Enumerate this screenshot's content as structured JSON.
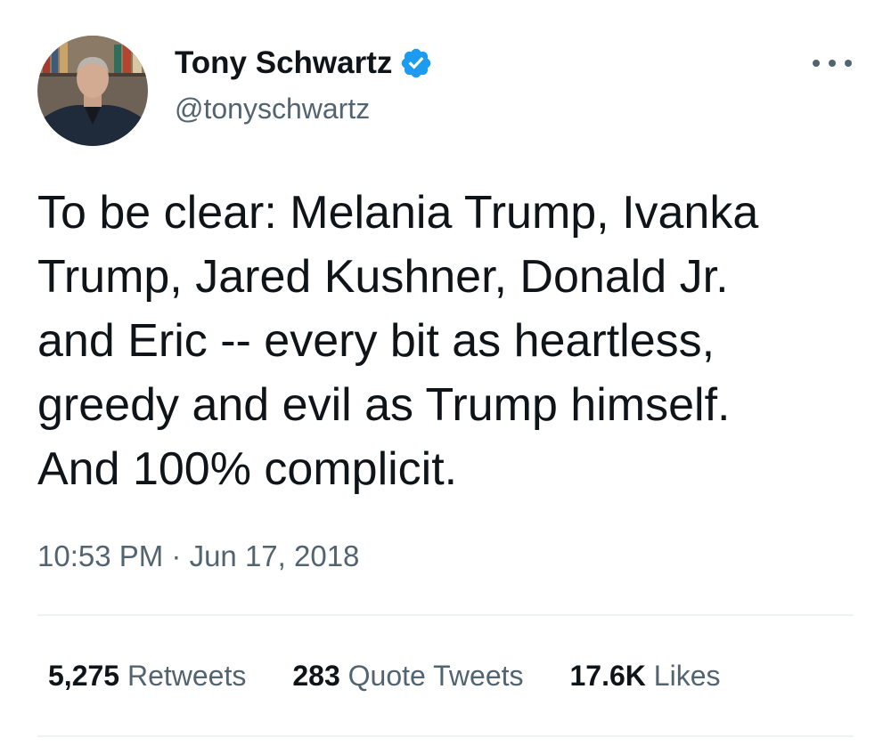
{
  "author": {
    "display_name": "Tony Schwartz",
    "handle": "@tonyschwartz",
    "verified": true
  },
  "tweet": {
    "text": "To be clear: Melania Trump, Ivanka\nTrump, Jared Kushner, Donald Jr.\nand Eric -- every bit as heartless,\ngreedy and evil as Trump himself.\nAnd 100% complicit.",
    "timestamp": "10:53 PM · Jun 17, 2018"
  },
  "stats": {
    "retweets_count": "5,275",
    "retweets_label": "Retweets",
    "quotes_count": "283",
    "quotes_label": "Quote Tweets",
    "likes_count": "17.6K",
    "likes_label": "Likes"
  },
  "colors": {
    "text_primary": "#0f1419",
    "text_secondary": "#536471",
    "verified_blue": "#1d9bf0",
    "divider": "#eff3f4"
  },
  "icons": {
    "verified": "verified-badge-icon",
    "more": "more-options-icon"
  }
}
